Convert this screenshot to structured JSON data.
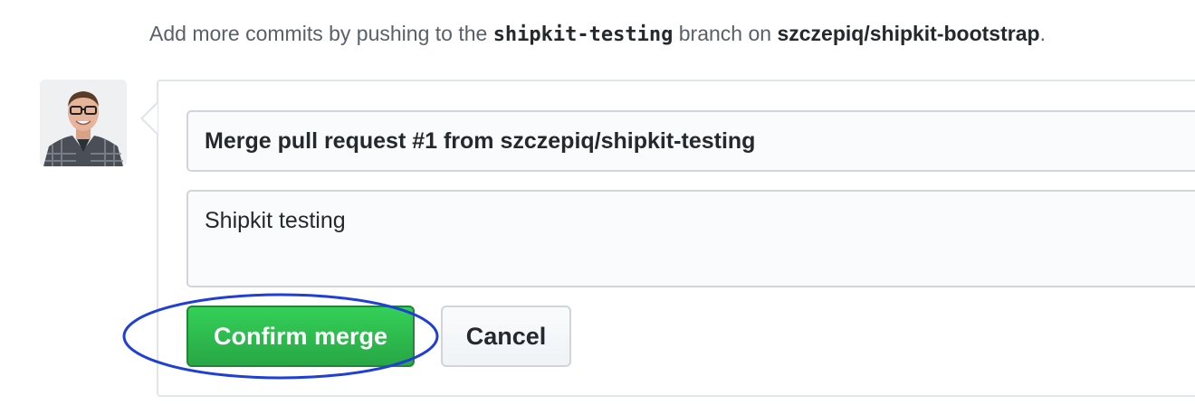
{
  "merge_hint": {
    "prefix": "Add more commits by pushing to the ",
    "branch": "shipkit-testing",
    "middle": " branch on ",
    "repo": "szczepiq/shipkit-bootstrap",
    "suffix": "."
  },
  "merge_form": {
    "title_value": "Merge pull request #1 from szczepiq/shipkit-testing",
    "message_value": "Shipkit testing",
    "confirm_label": "Confirm merge",
    "cancel_label": "Cancel"
  },
  "colors": {
    "confirm_green": "#2ea44f",
    "annotation_blue": "#1f3fd6"
  }
}
